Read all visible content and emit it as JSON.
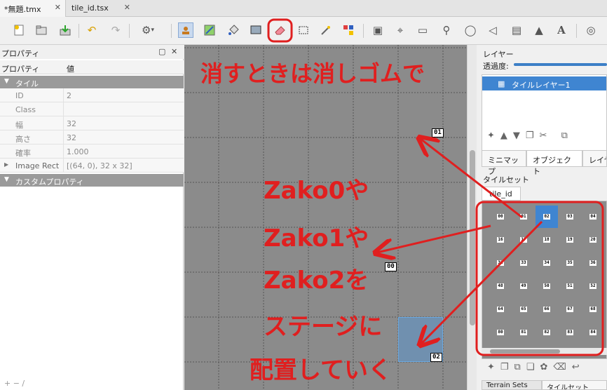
{
  "tabs": [
    {
      "label": "*無題.tmx",
      "close": "✕"
    },
    {
      "label": "tile_id.tsx",
      "close": "✕"
    }
  ],
  "toolbar": {
    "icons": [
      "new-icon",
      "open-icon",
      "save-icon",
      "undo-icon",
      "redo-icon",
      "settings-icon",
      "stamp-icon",
      "terrain-brush-icon",
      "fill-icon",
      "shape-fill-icon",
      "eraser-icon",
      "rect-select-icon",
      "magic-wand-icon",
      "select-same-icon",
      "object-select-icon",
      "edit-polygon-icon",
      "insert-rect-icon",
      "insert-point-icon",
      "insert-ellipse-icon",
      "insert-polygon-icon",
      "insert-tile-icon",
      "insert-template-icon",
      "insert-text-icon",
      "world-icon"
    ]
  },
  "properties": {
    "title": "プロパティ",
    "col_name": "プロパティ",
    "col_value": "値",
    "group_tile": "タイル",
    "rows": [
      {
        "key": "ID",
        "value": "2"
      },
      {
        "key": "Class",
        "value": ""
      },
      {
        "key": "幅",
        "value": "32"
      },
      {
        "key": "高さ",
        "value": "32"
      },
      {
        "key": "確率",
        "value": "1.000"
      },
      {
        "key": "Image Rect",
        "value": "[(64, 0), 32 x 32]"
      }
    ],
    "group_custom": "カスタムプロパティ",
    "bottom_icons": "+ − ∕"
  },
  "map": {
    "labels": [
      "01",
      "00",
      "02"
    ]
  },
  "layers": {
    "title": "レイヤー",
    "opacity_label": "透過度:",
    "layer_name": "タイルレイヤー1",
    "tabs": [
      "ミニマップ",
      "オブジェクト",
      "レイヤ"
    ]
  },
  "tileset": {
    "title": "タイルセット",
    "tab": "tile_id",
    "grid": [
      "00",
      "01",
      "02",
      "03",
      "04",
      "16",
      "17",
      "18",
      "19",
      "20",
      "32",
      "33",
      "34",
      "35",
      "36",
      "48",
      "49",
      "50",
      "51",
      "52",
      "64",
      "65",
      "66",
      "67",
      "68",
      "80",
      "81",
      "82",
      "83",
      "84"
    ],
    "selected": "02",
    "bottom_tabs": [
      "Terrain Sets",
      "タイルセット"
    ]
  },
  "annotations": {
    "eraser_note": "消すときは消しゴムで",
    "line1": "Zako0や",
    "line2": "Zako1や",
    "line3": "Zako2を",
    "line4": "ステージに",
    "line5": "配置していく"
  },
  "colors": {
    "accent": "#3f85d1",
    "annotation": "#e01f1f",
    "map_bg": "#8b8b8b"
  }
}
